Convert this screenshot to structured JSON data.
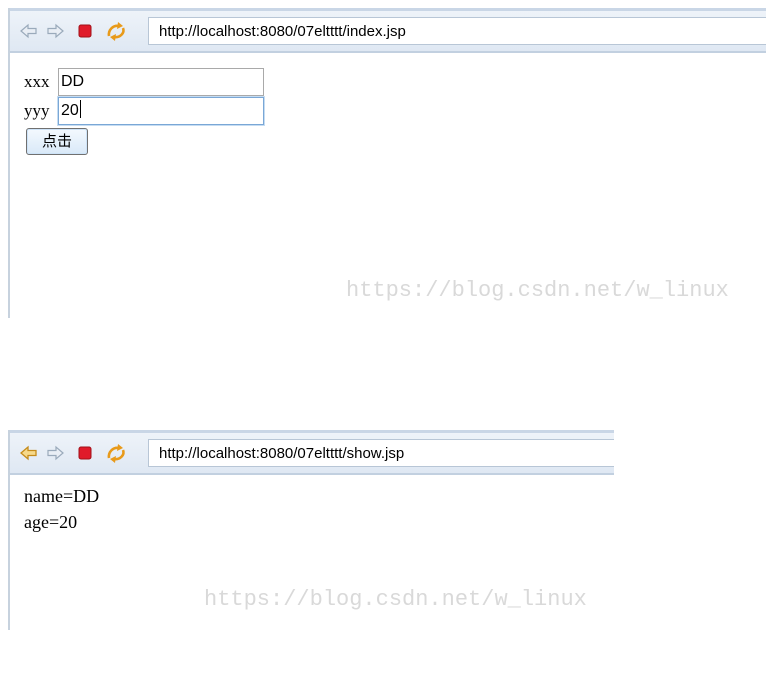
{
  "colors": {
    "toolbar": "#dfe8f3",
    "back_arrow": "#c58b1a",
    "stop": "#e01b2a",
    "watermark": "#d9d9d9"
  },
  "window1": {
    "toolbar": {
      "icons": [
        "back-arrow-icon",
        "forward-arrow-icon",
        "stop-icon",
        "refresh-icon"
      ],
      "url": "http://localhost:8080/07eltttt/index.jsp"
    },
    "form": {
      "xxx_label": "xxx",
      "xxx_value": "DD",
      "yyy_label": "yyy",
      "yyy_value": "20",
      "submit_label": "点击"
    },
    "watermark": "https://blog.csdn.net/w_linux"
  },
  "window2": {
    "toolbar": {
      "icons": [
        "back-arrow-icon",
        "forward-arrow-icon",
        "stop-icon",
        "refresh-icon"
      ],
      "url": "http://localhost:8080/07eltttt/show.jsp"
    },
    "output": {
      "name_line": "name=DD",
      "age_line": "age=20"
    },
    "watermark": "https://blog.csdn.net/w_linux"
  }
}
